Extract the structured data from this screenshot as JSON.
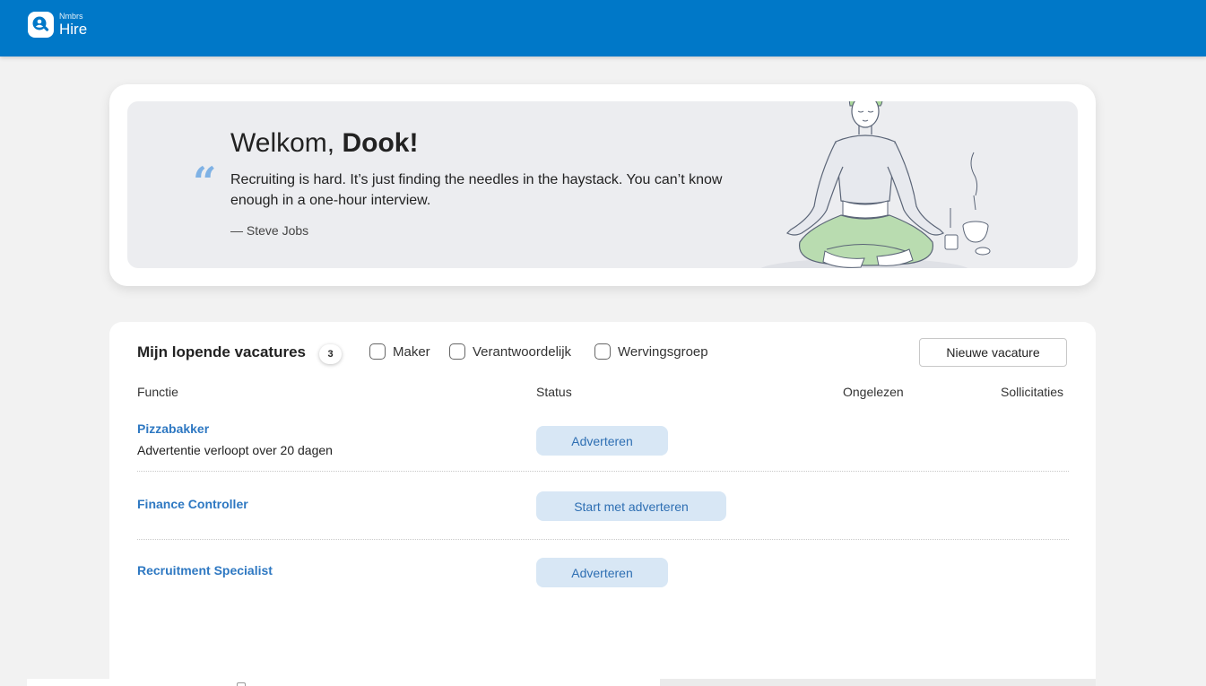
{
  "header": {
    "brand_small": "Nmbrs",
    "brand_big": "Hire",
    "logo_icon": "search-person-icon",
    "background_color": "#0078c8"
  },
  "welcome": {
    "greeting": "Welkom,",
    "name": "Dook!",
    "quote": "Recruiting is hard. It’s just finding the needles in the haystack. You can’t know enough in a one-hour interview.",
    "author": "— Steve Jobs",
    "quote_mark": "“",
    "illustration": "meditating-person-illustration"
  },
  "vacancies": {
    "title": "Mijn lopende vacatures",
    "count": "3",
    "filters": [
      {
        "label": "Maker",
        "checked": false
      },
      {
        "label": "Verantwoordelijk",
        "checked": false
      },
      {
        "label": "Wervingsgroep",
        "checked": false
      }
    ],
    "new_button": "Nieuwe vacature",
    "columns": {
      "function": "Functie",
      "status": "Status",
      "unread": "Ongelezen",
      "applications": "Sollicitaties"
    },
    "rows": [
      {
        "title": "Pizzabakker",
        "subtitle": "Advertentie verloopt over 20 dagen",
        "status": "Adverteren"
      },
      {
        "title": "Finance Controller",
        "subtitle": "",
        "status": "Start met adverteren"
      },
      {
        "title": "Recruitment Specialist",
        "subtitle": "",
        "status": "Adverteren"
      }
    ],
    "link_color": "#2e78c2",
    "status_button_color": "#d8e7f5"
  }
}
